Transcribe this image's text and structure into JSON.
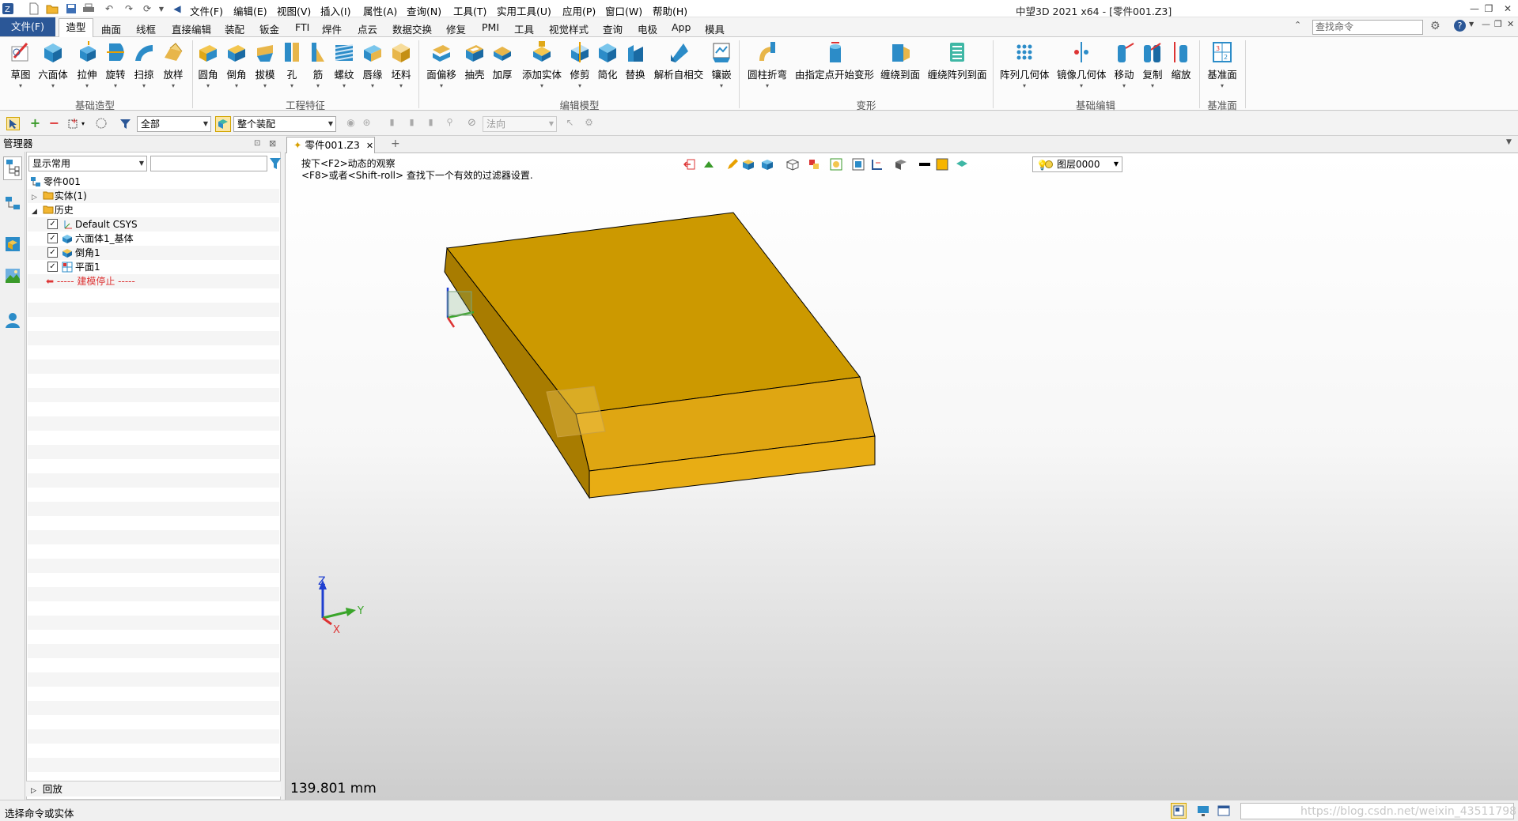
{
  "title_bar": {
    "title": "中望3D 2021 x64 - [零件001.Z3]",
    "menus": [
      "文件(F)",
      "编辑(E)",
      "视图(V)",
      "插入(I)",
      "属性(A)",
      "查询(N)",
      "工具(T)",
      "实用工具(U)",
      "应用(P)",
      "窗口(W)",
      "帮助(H)"
    ]
  },
  "ribbon_tabs": {
    "file": "文件(F)",
    "active": "造型",
    "tabs": [
      "曲面",
      "线框",
      "直接编辑",
      "装配",
      "钣金",
      "FTI",
      "焊件",
      "点云",
      "数据交换",
      "修复",
      "PMI",
      "工具",
      "视觉样式",
      "查询",
      "电极",
      "App",
      "模具"
    ],
    "search_placeholder": "查找命令"
  },
  "ribbon": {
    "buttons": [
      "草图",
      "六面体",
      "拉伸",
      "旋转",
      "扫掠",
      "放样",
      "圆角",
      "倒角",
      "拔模",
      "孔",
      "筋",
      "螺纹",
      "唇缘",
      "坯料",
      "面偏移",
      "抽壳",
      "加厚",
      "添加实体",
      "修剪",
      "简化",
      "替换",
      "解析自相交",
      "镶嵌",
      "圆柱折弯",
      "由指定点开始变形",
      "缠绕到面",
      "缠绕阵列到面",
      "阵列几何体",
      "镜像几何体",
      "移动",
      "复制",
      "缩放",
      "基准面"
    ],
    "groups": [
      "基础造型",
      "工程特征",
      "编辑模型",
      "变形",
      "基础编辑",
      "基准面"
    ]
  },
  "toolbar": {
    "filter_value": "全部",
    "assembly_value": "整个装配",
    "direction_value": "法向"
  },
  "manager": {
    "title": "管理器",
    "display_value": "显示常用",
    "tree": {
      "root": "零件001",
      "solid": "实体(1)",
      "history": "历史",
      "items": [
        "Default CSYS",
        "六面体1_基体",
        "倒角1",
        "平面1"
      ],
      "stop": "----- 建模停止 -----"
    },
    "rollback": "回放"
  },
  "document": {
    "tab": "零件001.Z3",
    "hint1": "按下<F2>动态的观察",
    "hint2": "<F8>或者<Shift-roll> 查找下一个有效的过滤器设置.",
    "layer": "图层0000",
    "measure": "139.801 mm",
    "axes": {
      "z": "Z",
      "y": "Y",
      "x": "X"
    }
  },
  "colors": {
    "accent": "#2b5797",
    "solid_top": "#cc9900",
    "solid_front": "#e0a817",
    "solid_side": "#aa7c00"
  },
  "status": {
    "text": "选择命令或实体",
    "watermark": "https://blog.csdn.net/weixin_43511798"
  }
}
